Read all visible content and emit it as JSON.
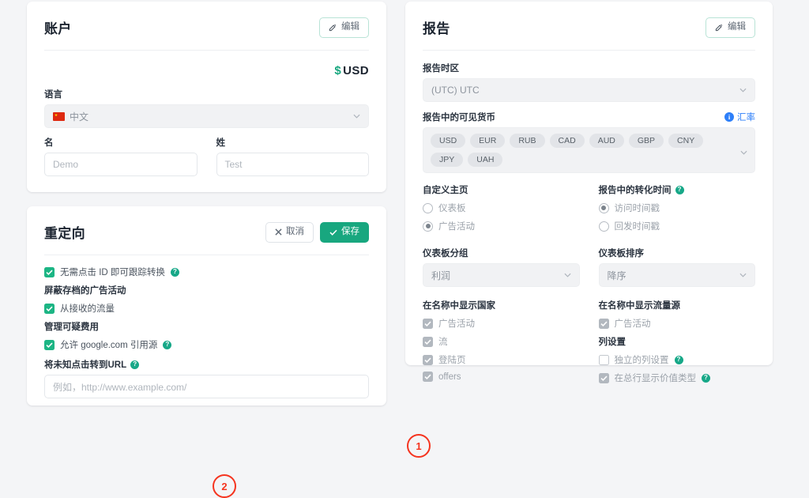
{
  "account": {
    "title": "账户",
    "edit_label": "编辑",
    "currency_symbol": "$",
    "currency_code": "USD",
    "language_label": "语言",
    "language_value": "中文",
    "first_name_label": "名",
    "first_name_placeholder": "Demo",
    "last_name_label": "姓",
    "last_name_placeholder": "Test"
  },
  "redirect": {
    "title": "重定向",
    "cancel_label": "取消",
    "save_label": "保存",
    "track_conv_label": "无需点击 ID 即可跟踪转换",
    "block_archived_heading": "屏蔽存档的广告活动",
    "from_received_traffic_label": "从接收的流量",
    "manage_suspicious_heading": "管理可疑费用",
    "allow_google_label": "允许 google.com 引用源",
    "unknown_clicks_label": "将未知点击转到URL",
    "unknown_clicks_placeholder": "例如，http://www.example.com/"
  },
  "report": {
    "title": "报告",
    "edit_label": "编辑",
    "timezone_label": "报告时区",
    "timezone_value": "(UTC) UTC",
    "visible_currencies_label": "报告中的可见货币",
    "rate_link_label": "汇率",
    "currency_tags": [
      "USD",
      "EUR",
      "RUB",
      "CAD",
      "AUD",
      "GBP",
      "CNY",
      "JPY",
      "UAH"
    ],
    "custom_home_label": "自定义主页",
    "custom_home_options": [
      {
        "label": "仪表板",
        "selected": false
      },
      {
        "label": "广告活动",
        "selected": true
      }
    ],
    "conversion_time_label": "报告中的转化时间",
    "conversion_time_options": [
      {
        "label": "访问时间戳",
        "selected": true
      },
      {
        "label": "回发时间戳",
        "selected": false
      }
    ],
    "dashboard_group_label": "仪表板分组",
    "dashboard_group_value": "利润",
    "dashboard_sort_label": "仪表板排序",
    "dashboard_sort_value": "降序",
    "show_country_label": "在名称中显示国家",
    "show_country_items": [
      {
        "label": "广告活动",
        "checked": true
      },
      {
        "label": "流",
        "checked": true
      },
      {
        "label": "登陆页",
        "checked": true
      },
      {
        "label": "offers",
        "checked": true
      }
    ],
    "show_source_label": "在名称中显示流量源",
    "show_source_items": [
      {
        "label": "广告活动",
        "checked": true
      }
    ],
    "column_settings_label": "列设置",
    "column_settings_items": [
      {
        "label": "独立的列设置",
        "checked": false
      },
      {
        "label": "在总行显示价值类型",
        "checked": true
      }
    ]
  },
  "annotations": [
    {
      "id": "1",
      "text": "1"
    },
    {
      "id": "2",
      "text": "2"
    }
  ]
}
